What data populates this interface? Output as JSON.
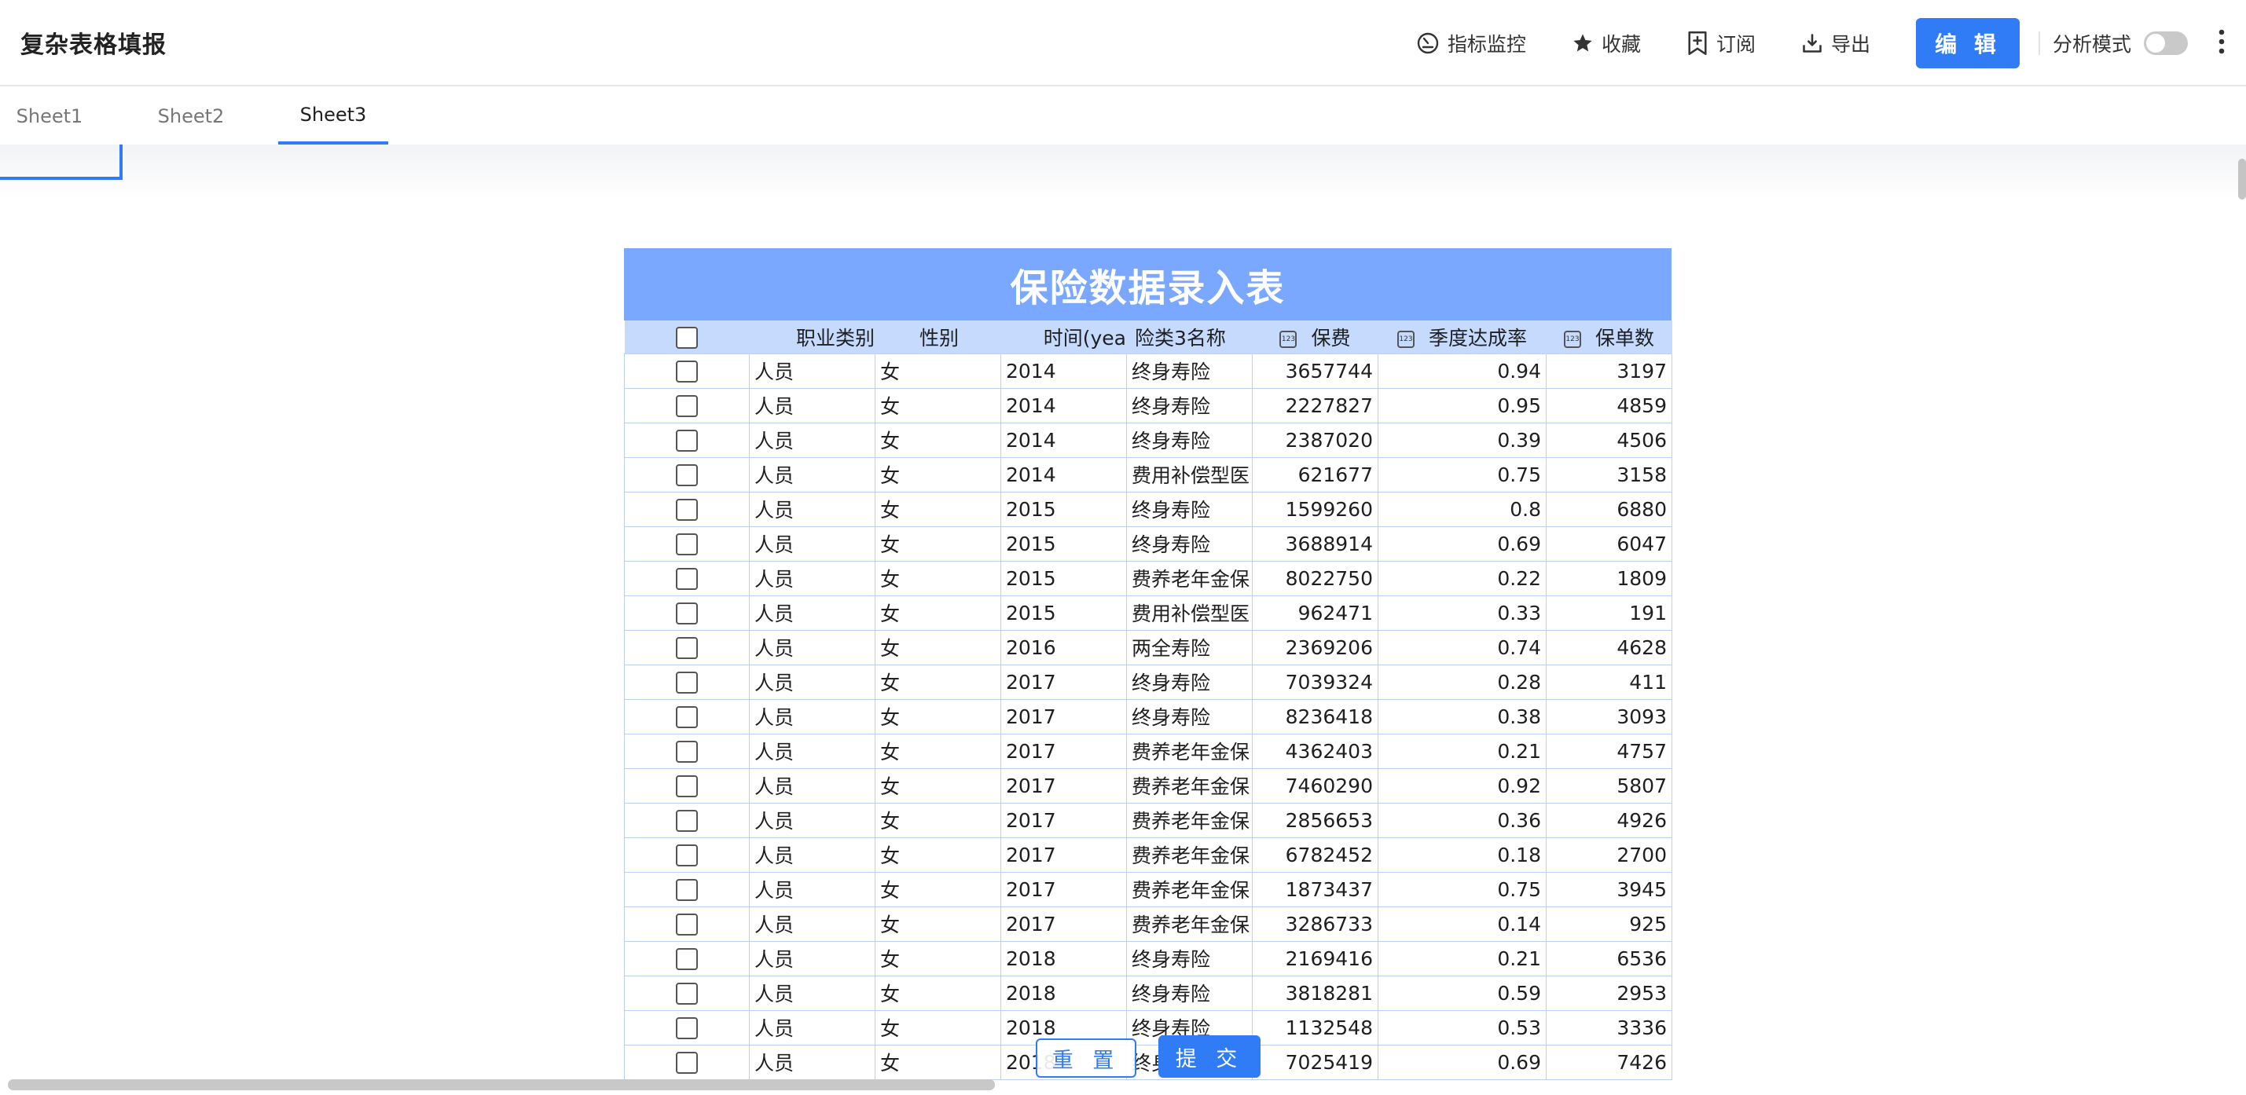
{
  "header": {
    "title": "复杂表格填报",
    "tools": [
      {
        "label": "指标监控",
        "icon": "gauge-icon"
      },
      {
        "label": "收藏",
        "icon": "star-icon"
      },
      {
        "label": "订阅",
        "icon": "bookmark-plus-icon"
      },
      {
        "label": "导出",
        "icon": "export-icon"
      }
    ],
    "edit_label": "编 辑",
    "analysis_mode_label": "分析模式",
    "analysis_mode_on": false
  },
  "tabs": [
    {
      "label": "Sheet1",
      "active": false
    },
    {
      "label": "Sheet2",
      "active": false
    },
    {
      "label": "Sheet3",
      "active": true
    }
  ],
  "sheet": {
    "title": "保险数据录入表",
    "columns": [
      "",
      "职业类别",
      "性别",
      "时间(yea",
      "险类3名称",
      "保费",
      "季度达成率",
      "保单数"
    ],
    "rows": [
      [
        "人员",
        "女",
        "2014",
        "终身寿险",
        "3657744",
        "0.94",
        "3197"
      ],
      [
        "人员",
        "女",
        "2014",
        "终身寿险",
        "2227827",
        "0.95",
        "4859"
      ],
      [
        "人员",
        "女",
        "2014",
        "终身寿险",
        "2387020",
        "0.39",
        "4506"
      ],
      [
        "人员",
        "女",
        "2014",
        "费用补偿型医",
        "621677",
        "0.75",
        "3158"
      ],
      [
        "人员",
        "女",
        "2015",
        "终身寿险",
        "1599260",
        "0.8",
        "6880"
      ],
      [
        "人员",
        "女",
        "2015",
        "终身寿险",
        "3688914",
        "0.69",
        "6047"
      ],
      [
        "人员",
        "女",
        "2015",
        "费养老年金保",
        "8022750",
        "0.22",
        "1809"
      ],
      [
        "人员",
        "女",
        "2015",
        "费用补偿型医",
        "962471",
        "0.33",
        "191"
      ],
      [
        "人员",
        "女",
        "2016",
        "两全寿险",
        "2369206",
        "0.74",
        "4628"
      ],
      [
        "人员",
        "女",
        "2017",
        "终身寿险",
        "7039324",
        "0.28",
        "411"
      ],
      [
        "人员",
        "女",
        "2017",
        "终身寿险",
        "8236418",
        "0.38",
        "3093"
      ],
      [
        "人员",
        "女",
        "2017",
        "费养老年金保",
        "4362403",
        "0.21",
        "4757"
      ],
      [
        "人员",
        "女",
        "2017",
        "费养老年金保",
        "7460290",
        "0.92",
        "5807"
      ],
      [
        "人员",
        "女",
        "2017",
        "费养老年金保",
        "2856653",
        "0.36",
        "4926"
      ],
      [
        "人员",
        "女",
        "2017",
        "费养老年金保",
        "6782452",
        "0.18",
        "2700"
      ],
      [
        "人员",
        "女",
        "2017",
        "费养老年金保",
        "1873437",
        "0.75",
        "3945"
      ],
      [
        "人员",
        "女",
        "2017",
        "费养老年金保",
        "3286733",
        "0.14",
        "925"
      ],
      [
        "人员",
        "女",
        "2018",
        "终身寿险",
        "2169416",
        "0.21",
        "6536"
      ],
      [
        "人员",
        "女",
        "2018",
        "终身寿险",
        "3818281",
        "0.59",
        "2953"
      ],
      [
        "人员",
        "女",
        "2018",
        "终身寿险",
        "1132548",
        "0.53",
        "3336"
      ],
      [
        "人员",
        "女",
        "2018",
        "终身寿险",
        "7025419",
        "0.69",
        "7426"
      ]
    ]
  },
  "footer": {
    "reset_label": "重 置",
    "submit_label": "提 交"
  },
  "colors": {
    "accent": "#2f7cf6",
    "sheet_title_bg": "#7aa7ff",
    "sheet_header_bg": "#c6dafe",
    "grid_line": "#bcd0f4"
  }
}
